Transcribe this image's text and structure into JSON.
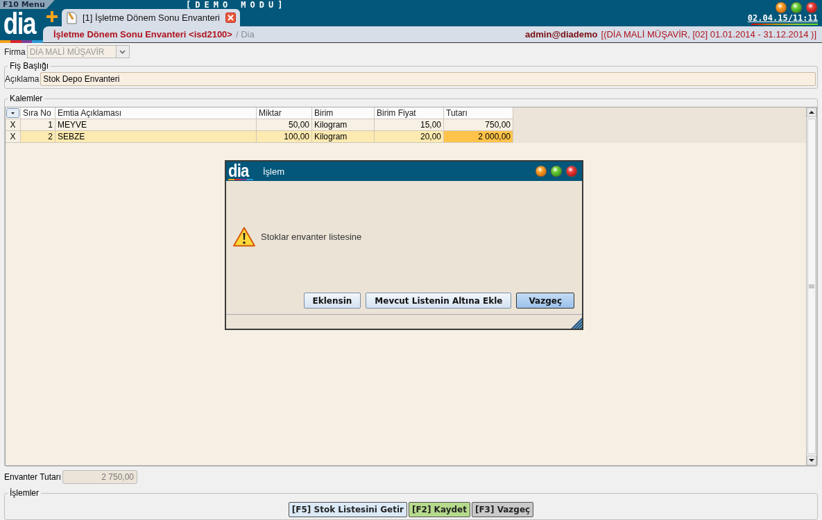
{
  "menu": {
    "label": "F10 Menu"
  },
  "banner": "[DEMO MODU]",
  "logo": "dia",
  "clock": "02.04.15/11:11",
  "tabs": [
    {
      "label": "[1] İşletme Dönem Sonu Envanteri",
      "selected": true
    }
  ],
  "header": {
    "title": "İşletme Dönem Sonu Envanteri <isd2100>",
    "subtitle": "/ Dia",
    "user": "admin@diademo",
    "context": "[(DİA MALİ MÜŞAVİR, [02] 01.01.2014 - 31.12.2014 )]"
  },
  "firma": {
    "label": "Firma",
    "value": "DİA MALİ MÜŞAVİR",
    "disabled": true
  },
  "fis_basligi": {
    "legend": "Fiş Başlığı",
    "label": "Açıklama",
    "value": "Stok Depo Envanteri"
  },
  "kalemler": {
    "legend": "Kalemler",
    "columns": [
      {
        "label": "Sıra No",
        "kind": "number"
      },
      {
        "label": "Emtia Açıklaması",
        "kind": "text"
      },
      {
        "label": "Miktar",
        "kind": "number"
      },
      {
        "label": "Birim",
        "kind": "text"
      },
      {
        "label": "Birim Fiyat",
        "kind": "number"
      },
      {
        "label": "Tutarı",
        "kind": "number"
      }
    ],
    "rows": [
      {
        "marker": "X",
        "selected": false,
        "cells": [
          {
            "text": "1",
            "focused": false
          },
          {
            "text": "MEYVE",
            "focused": false
          },
          {
            "text": "50,00",
            "focused": false
          },
          {
            "text": "Kilogram",
            "focused": false
          },
          {
            "text": "15,00",
            "focused": false
          },
          {
            "text": "750,00",
            "focused": false
          }
        ]
      },
      {
        "marker": "X",
        "selected": true,
        "cells": [
          {
            "text": "2",
            "focused": false
          },
          {
            "text": "SEBZE",
            "focused": false
          },
          {
            "text": "100,00",
            "focused": false
          },
          {
            "text": "Kilogram",
            "focused": false
          },
          {
            "text": "20,00",
            "focused": false
          },
          {
            "text": "2 000,00",
            "focused": true
          }
        ]
      }
    ]
  },
  "total": {
    "label": "Envanter Tutarı",
    "value": "2 750,00",
    "disabled": true
  },
  "islemler": {
    "legend": "İşlemler",
    "buttons": [
      {
        "label": "[F5] Stok Listesini Getir",
        "color": "#dce9f7"
      },
      {
        "label": "[F2] Kaydet",
        "color": "#b6da8c"
      },
      {
        "label": "[F3] Vazgeç",
        "color": "#c9c9c9"
      }
    ]
  },
  "dialog": {
    "logo": "dia",
    "title": "İşlem",
    "message": "Stoklar envanter listesine",
    "buttons": [
      {
        "label": "Eklensin",
        "default": false
      },
      {
        "label": "Mevcut Listenin Altına Ekle",
        "default": false
      },
      {
        "label": "Vazgeç",
        "default": true
      }
    ]
  }
}
